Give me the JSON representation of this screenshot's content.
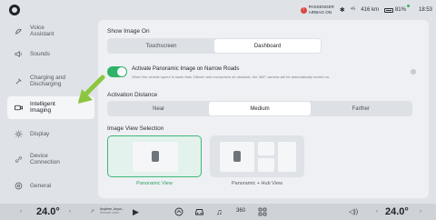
{
  "status_bar": {
    "airbag_line1": "PASSENGER",
    "airbag_line2": "AIRBAG ON",
    "range": "416 km",
    "battery": "81%",
    "time": "18:53"
  },
  "sidebar": {
    "items": [
      {
        "label": "Voice\nAssistant",
        "icon": "voice-icon"
      },
      {
        "label": "Sounds",
        "icon": "speaker-icon"
      },
      {
        "label": "Charging and\nDischarging",
        "icon": "plug-icon"
      },
      {
        "label": "Intelligent\nImaging",
        "icon": "camera-icon",
        "active": true
      },
      {
        "label": "Display",
        "icon": "sun-icon"
      },
      {
        "label": "Device\nConnection",
        "icon": "link-icon"
      },
      {
        "label": "General",
        "icon": "gear-icon"
      }
    ]
  },
  "main": {
    "show_image_on": {
      "title": "Show Image On",
      "options": [
        "Touchscreen",
        "Dashboard"
      ],
      "selected": "Dashboard"
    },
    "panoramic_toggle": {
      "title": "Activate Panoramic Image on Narrow Roads",
      "description": "When the vehicle speed is lower than 15km/h and encounters an obstacle, the 360° camera will be automatically turned on.",
      "enabled": true
    },
    "activation_distance": {
      "title": "Activation Distance",
      "options": [
        "Near",
        "Medium",
        "Farther"
      ],
      "selected": "Medium"
    },
    "image_view": {
      "title": "Image View Selection",
      "options": [
        "Panoramic View",
        "Panoramic + Hub View"
      ],
      "selected": "Panoramic View"
    }
  },
  "bottom_bar": {
    "left_temp": "24.0°",
    "right_temp": "24.0°",
    "media_line1": "Anytime, Anyw...",
    "media_line2": "Siemah radio",
    "dock_icons": [
      "home-icon",
      "car-icon",
      "music-icon",
      "360-camera-icon",
      "apps-icon"
    ],
    "dock_360_label": "360"
  },
  "colors": {
    "accent_green": "#2fb36a",
    "arrow_green": "#8cc63f"
  }
}
